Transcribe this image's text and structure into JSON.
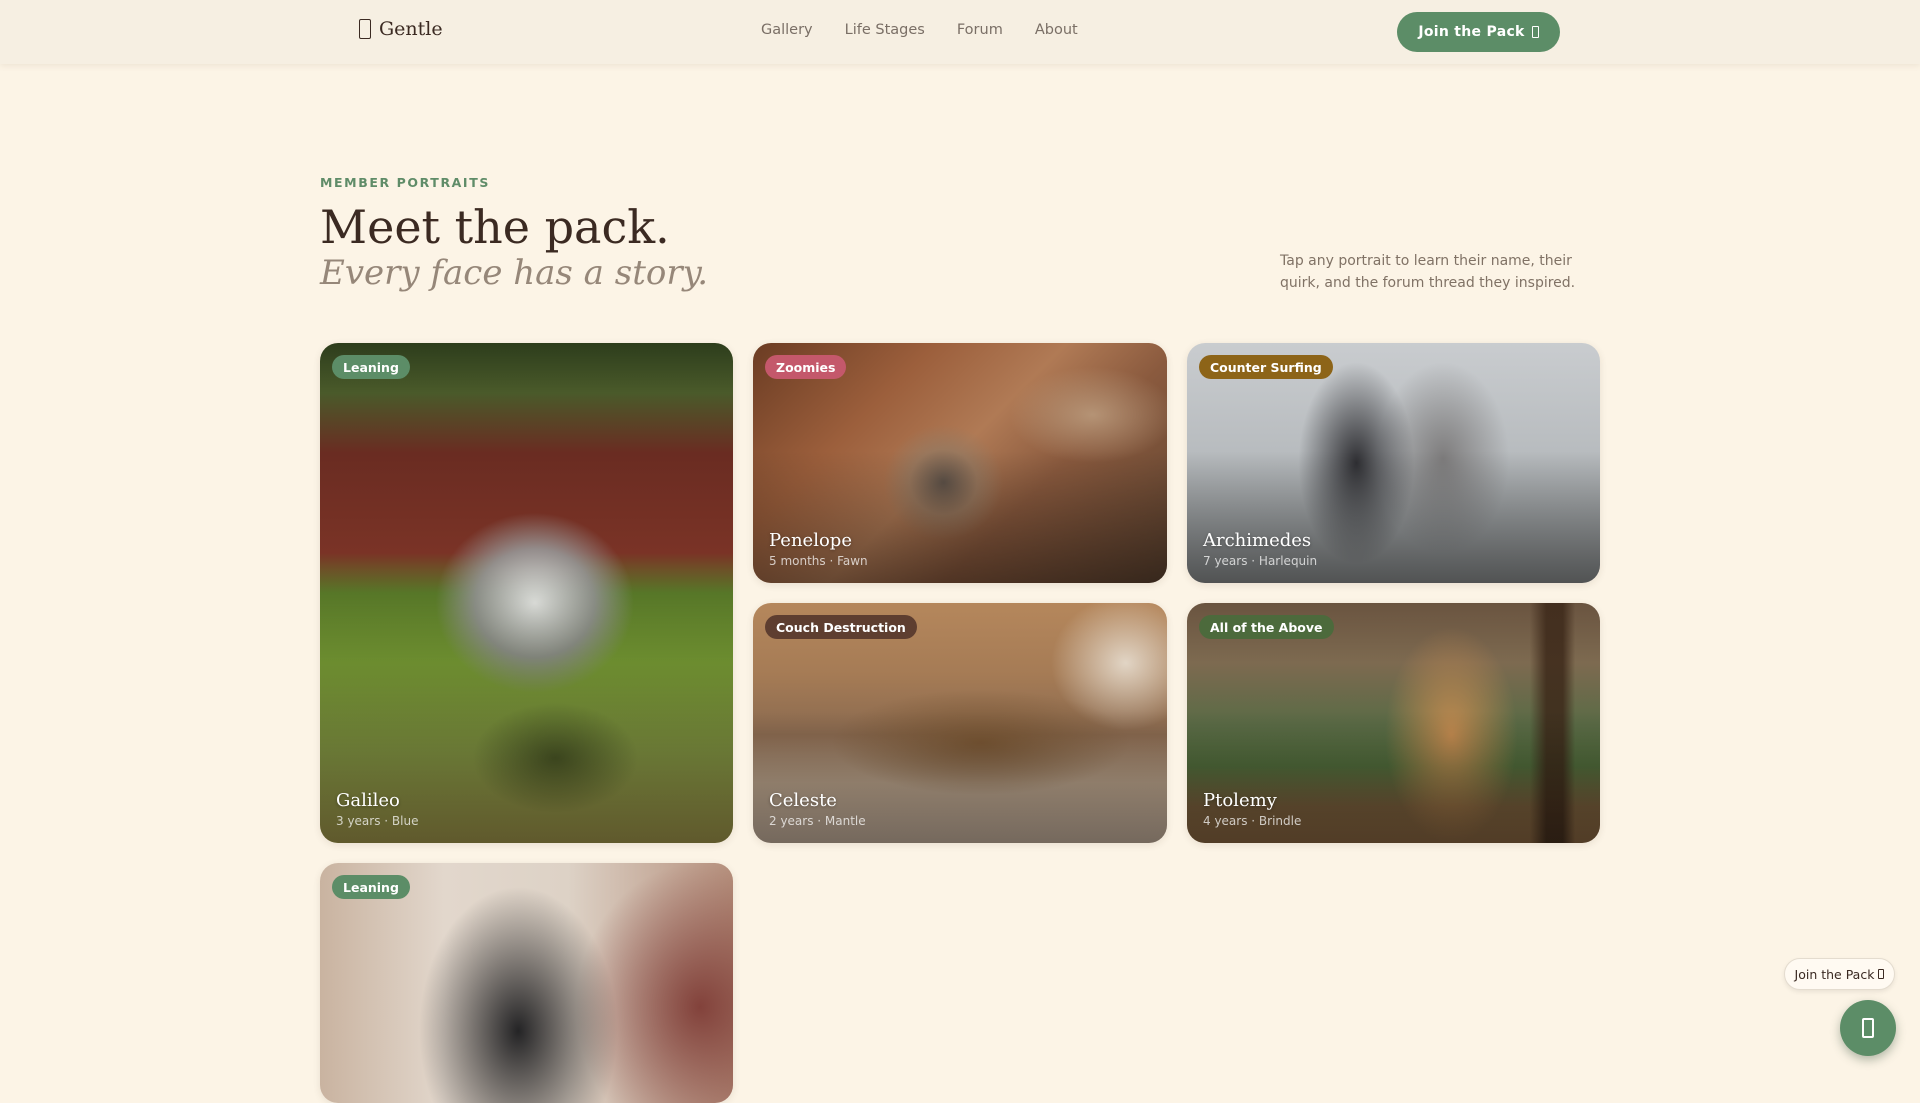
{
  "header": {
    "logo_text": "Gentle",
    "nav": [
      "Gallery",
      "Life Stages",
      "Forum",
      "About"
    ],
    "cta_label": "Join the Pack"
  },
  "intro": {
    "eyebrow": "MEMBER PORTRAITS",
    "title": "Meet the pack.",
    "subtitle": "Every face has a story.",
    "note": "Tap any portrait to learn their name, their quirk, and the forum thread they inspired."
  },
  "colors": {
    "background": "#fcf4e6",
    "accent_green": "#5c8d67",
    "badge_pink": "#c4586b",
    "badge_amber": "#8d6418",
    "badge_brown": "#5e3e30",
    "badge_dark_green": "#4c6a3c"
  },
  "cards": [
    {
      "badge": "Leaning",
      "badge_color": "#5c8d67",
      "name": "Galileo",
      "meta": "3 years · Blue"
    },
    {
      "badge": "Zoomies",
      "badge_color": "#c4586b",
      "name": "Penelope",
      "meta": "5 months · Fawn"
    },
    {
      "badge": "Counter Surfing",
      "badge_color": "#8d6418",
      "name": "Archimedes",
      "meta": "7 years · Harlequin"
    },
    {
      "badge": "Couch Destruction",
      "badge_color": "#5e3e30",
      "name": "Celeste",
      "meta": "2 years · Mantle"
    },
    {
      "badge": "All of the Above",
      "badge_color": "#4c6a3c",
      "name": "Ptolemy",
      "meta": "4 years · Brindle"
    },
    {
      "badge": "Leaning",
      "badge_color": "#5c8d67",
      "name": "",
      "meta": ""
    }
  ],
  "floating": {
    "pill_label": "Join the Pack"
  }
}
